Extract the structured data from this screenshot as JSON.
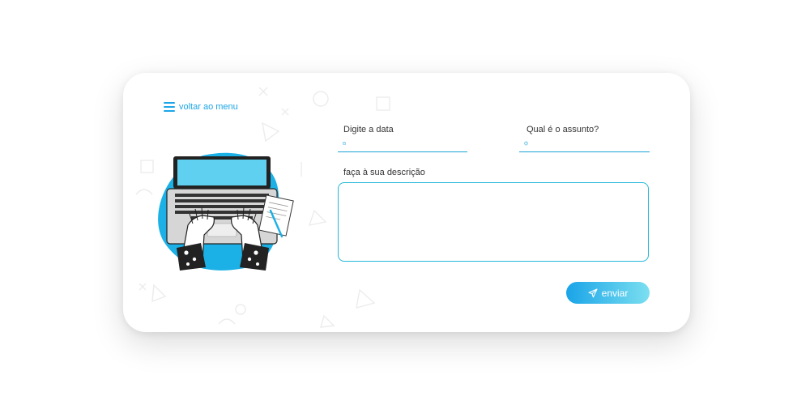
{
  "nav": {
    "back_label": "voltar ao menu",
    "back_icon": "hamburger-menu-icon"
  },
  "form": {
    "date": {
      "label": "Digite a data",
      "value": "",
      "icon": "calendar-icon"
    },
    "subject": {
      "label": "Qual é o assunto?",
      "value": "",
      "icon": "help-circle-icon"
    },
    "description": {
      "label": "faça à sua descrição",
      "value": ""
    },
    "submit": {
      "label": "enviar",
      "icon": "send-icon"
    }
  },
  "colors": {
    "accent": "#1aa3d6",
    "button_gradient_start": "#1aa4e8",
    "button_gradient_end": "#7bdff0",
    "illustration_blob": "#1bb0e6"
  }
}
